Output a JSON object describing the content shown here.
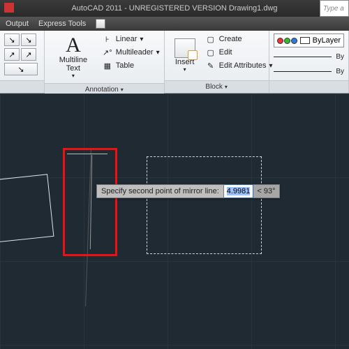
{
  "title": "AutoCAD 2011 - UNREGISTERED VERSION    Drawing1.dwg",
  "search_placeholder": "Type a",
  "tabs": {
    "output": "Output",
    "express": "Express Tools"
  },
  "annotation": {
    "textBtn": "Multiline Text",
    "linear": "Linear",
    "multileader": "Multileader",
    "table": "Table",
    "panel": "Annotation"
  },
  "block": {
    "insert": "Insert",
    "create": "Create",
    "edit": "Edit",
    "editAttr": "Edit Attributes",
    "panel": "Block"
  },
  "props": {
    "layerName": "ByLayer",
    "line1": "By",
    "line2": "By"
  },
  "prompt": {
    "text": "Specify second point of mirror line:",
    "value": "4.9981",
    "angle": "< 93°"
  }
}
